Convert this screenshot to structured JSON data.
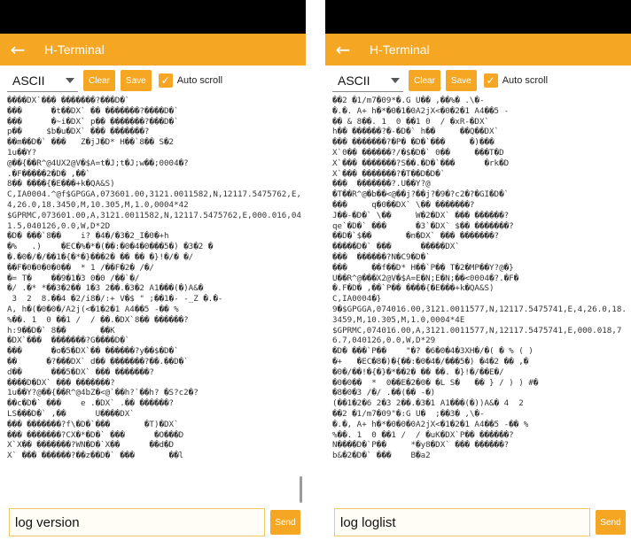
{
  "left": {
    "title": "H-Terminal",
    "encoding": "ASCII",
    "clear_label": "Clear",
    "save_label": "Save",
    "autoscroll_label": "Auto scroll",
    "log_text": "DX` ?D`\n      tDX`  ?D`\n      ~iDX` p ?D`\np     $buDX`  ?\nmD`    ZjJD* H`8 S2\n1uY?\n@{R^@4UX2@V$A=tJ;tJ;w;0004?\n.F2D ,`\n8 {E+kQA&S)\nC,IA0004.^@f$GPGGA,073601.00,3121.0011582,N,12117.5475762,E,4,26.0,18.3450,M,10.305,M,1.0,0004*42\n$GPRMC,073601.00,A,3121.0011582,N,12117.5475762,E,000.016,041.5,040126,0.0,W,D*2D\nD `8    i? 4/32_I0+h\n%   .)    EC%*(:0405) 32 \n.0//1{*}2   }!/ /\nF0000  * 1 /F2 //\n= T    913 00 /`/\n/ .* *32 13 2.32 A1()A&\n 3  2  8.4 2/i8/:+ V$ \" ;1- -_Z .-\nA, h(00/A2j(<121 A45 - %\n%. 1  0 1 /  / .DX`8 ?\nh:9D` 8       K\nDX`  ?GD`\n      o5DX` ?y$D`\n      ?DX` d ?.D`\nd      5DX`  ?\nDDX`  ?\n1uY?@{R^@4bZ<@`h?`h? S?c2?\ncD`     e .DX` . ?\nLSD` ,      UDX`\n ?f\\D`       T)DX`\n ?CX*D`       OD\nX`X ?WND`X      dD\nX`  ?zD`        l",
    "command": "log version",
    "send_label": "Send"
  },
  "right": {
    "title": "H-Terminal",
    "encoding": "ASCII",
    "clear_label": "Clear",
    "save_label": "Save",
    "autoscroll_label": "Auto scroll",
    "log_text": "2 1/m709*.G U ,% .\\-\n.. A+ h*010A2jX<021 A45 -\n & 8. 1  0 1 0  / xR-DX`\nh ?-D` h     QDX`\n ?P D`     )\nX`0 ?/$D` 0     TD\nX` ?S.D`      rkD\nX` ?TDD`\n  ?.UY?@\nTR^@b<@j?j?9?c2?GID`\n     q0DX` \\ ?\nJ-D` \\     W2DX`  ?\nqe`D`       3`DX` $ ?\nD`$       nDX`  ?\nD`       DX`\n  ?NC9D`\n     fD* H`P T2MPY?@}\nUR^@X2@V$A=EN;EN;<0004?.F\n.FD ,`P {E+kQA&S)\nC,IA0004}\n9$GPGGA,074016.00,3121.0011577,N,12117.5475741,E,4,26.0,18.3459,M,10.305,M,1.0,0004*4E\n$GPRMC,074016.00,A,3121.0011577,N,12117.5475741,E,000.018,76.7,040126,0.0,W,D*29\nD `P    \"? 6043XH/(  % ( )\n+   EC8){:04/5) 42  ,\n0/!{}*2  . }!/E/\n00  *  0E20 L S    } / ) ) #\n803 // .( -)\n(126 23 2.31 A1())A& 4  2\n2 1/m709\":G U  ;3 ,\\-\n., A+ h*000A2jX<121 A45 - %\n%. 1  0 1 /  / uKDX`P ?\nND`P     *y8DX`  ?\nb&2D`     Ba2",
    "command": "log loglist",
    "send_label": "Send"
  }
}
